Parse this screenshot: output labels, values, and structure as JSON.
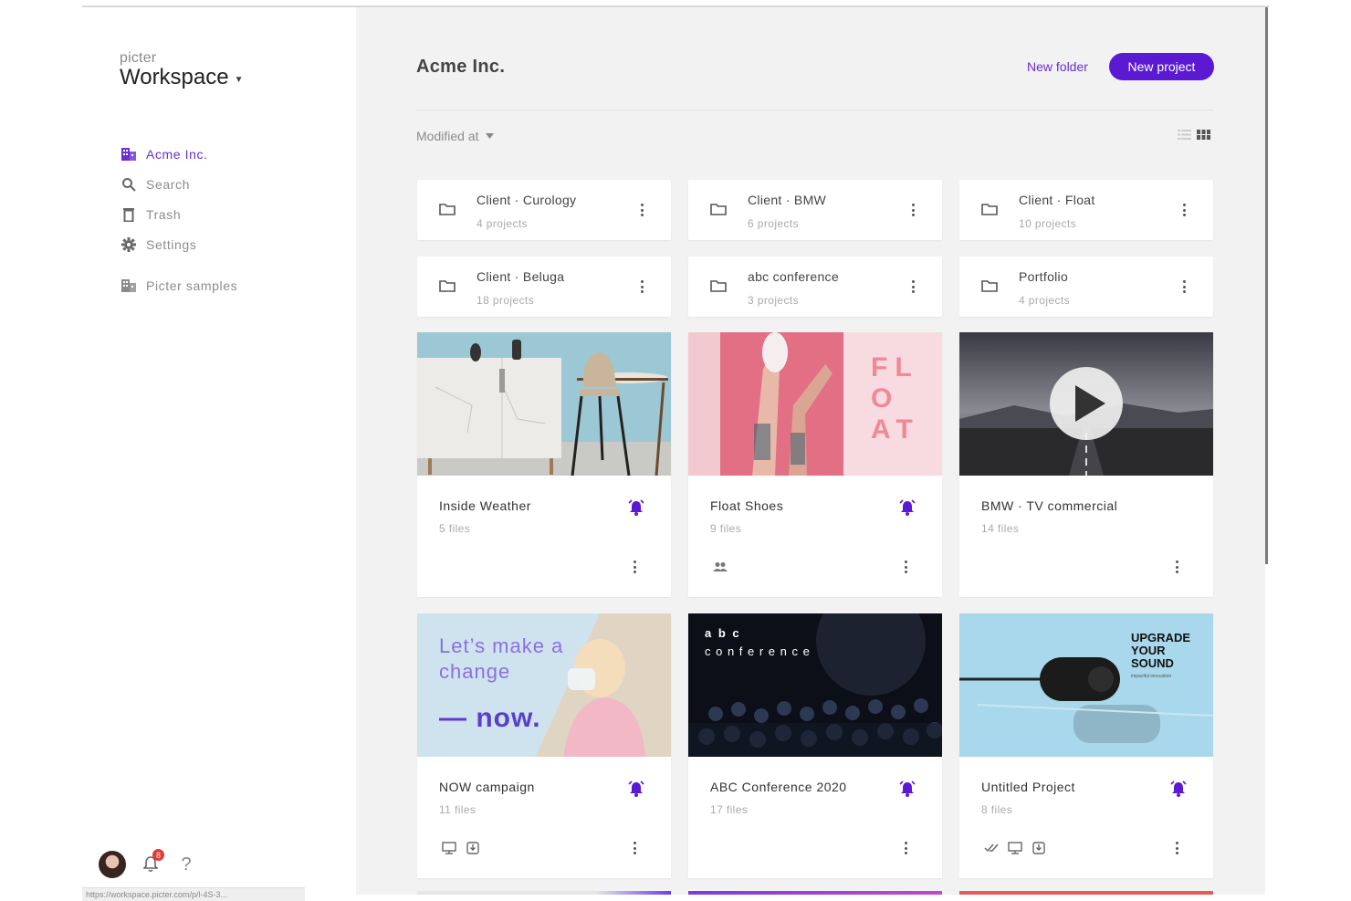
{
  "sidebar": {
    "brand_small": "picter",
    "brand_main": "Workspace",
    "nav": [
      {
        "label": "Acme Inc.",
        "icon": "building-icon"
      },
      {
        "label": "Search",
        "icon": "search-icon"
      },
      {
        "label": "Trash",
        "icon": "trash-icon"
      },
      {
        "label": "Settings",
        "icon": "gear-icon"
      },
      {
        "label": "Picter samples",
        "icon": "building-icon"
      }
    ],
    "notifications_count": "8",
    "help_label": "?",
    "status_url": "https://workspace.picter.com/p/l-4S-3..."
  },
  "header": {
    "title": "Acme Inc.",
    "new_folder": "New folder",
    "new_project": "New project"
  },
  "toolbar": {
    "sort_label": "Modified at"
  },
  "folders": [
    {
      "name": "Client · Curology",
      "count": "4 projects"
    },
    {
      "name": "Client · BMW",
      "count": "6 projects"
    },
    {
      "name": "Client · Float",
      "count": "10 projects"
    },
    {
      "name": "Client · Beluga",
      "count": "18 projects"
    },
    {
      "name": "abc conference",
      "count": "3 projects"
    },
    {
      "name": "Portfolio",
      "count": "4 projects"
    }
  ],
  "projects": [
    {
      "name": "Inside Weather",
      "count": "5 files",
      "alert": true
    },
    {
      "name": "Float Shoes",
      "count": "9 files",
      "alert": true
    },
    {
      "name": "BMW · TV commercial",
      "count": "14 files",
      "alert": false
    },
    {
      "name": "NOW campaign",
      "count": "11 files",
      "alert": true
    },
    {
      "name": "ABC Conference 2020",
      "count": "17 files",
      "alert": true
    },
    {
      "name": "Untitled Project",
      "count": "8 files",
      "alert": true
    }
  ],
  "thumbs": {
    "float_letters": "FLOAT",
    "now_line1": "Let’s make a",
    "now_line2": "change",
    "now_line3": "— now.",
    "abc_line1": "a b c",
    "abc_line2": "c o n f e r e n c e",
    "upgrade_line1": "UPGRADE",
    "upgrade_line2": "YOUR",
    "upgrade_line3": "SOUND",
    "upgrade_tag": "impactful innovation"
  },
  "colors": {
    "accent": "#5b19d4",
    "accent_text": "#6a2fd0",
    "background": "#f2f2f2"
  }
}
